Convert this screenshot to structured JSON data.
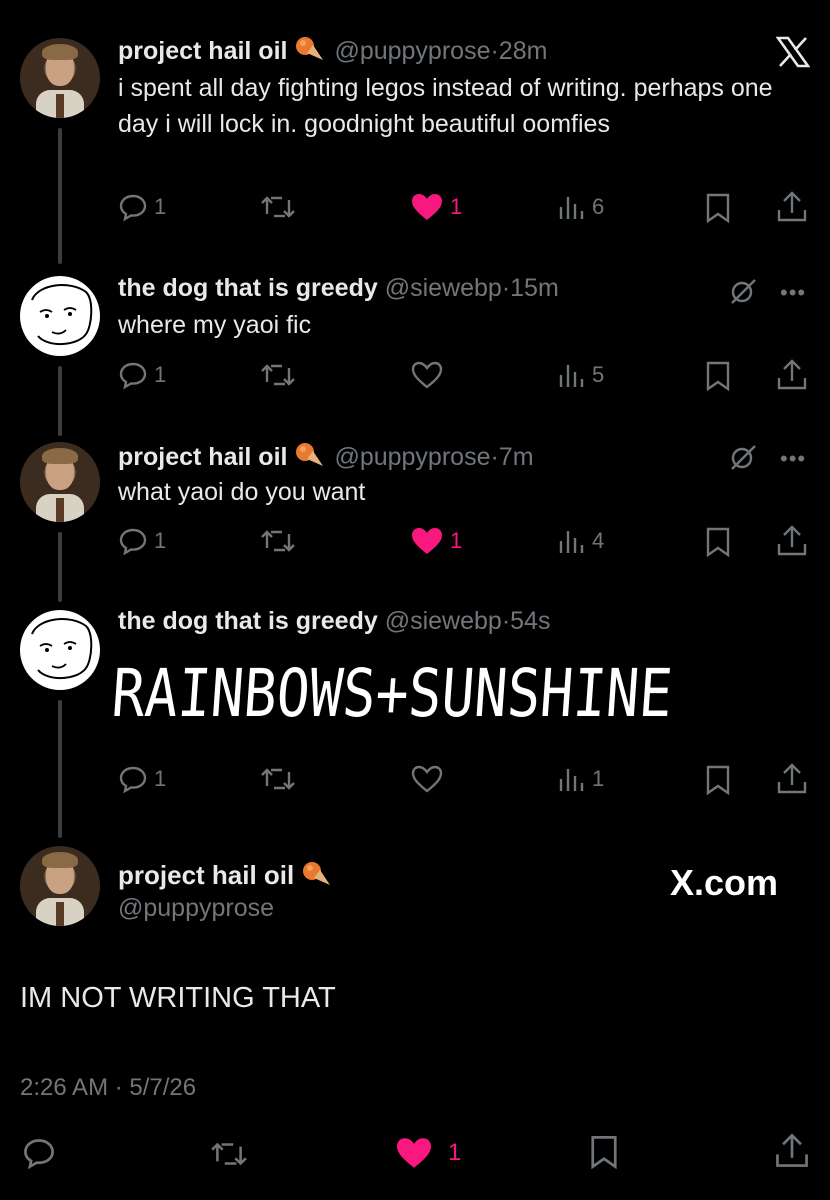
{
  "close_icon": "x-logo-icon",
  "posts": [
    {
      "name": "project hail oil",
      "handle": "@puppyprose",
      "sep": "·",
      "time": "28m",
      "text": "i spent all day fighting legos instead of writing. perhaps one day i will lock in. goodnight beautiful oomfies",
      "replies": "1",
      "likes": "1",
      "liked": true,
      "views": "6"
    },
    {
      "name": "the dog that is greedy",
      "handle": "@siewebp",
      "sep": "·",
      "time": "15m",
      "text": "where my yaoi fic",
      "replies": "1",
      "likes": "",
      "liked": false,
      "views": "5"
    },
    {
      "name": "project hail oil",
      "handle": "@puppyprose",
      "sep": "·",
      "time": "7m",
      "text": "what yaoi do you want",
      "replies": "1",
      "likes": "1",
      "liked": true,
      "views": "4"
    },
    {
      "name": "the dog that is greedy",
      "handle": "@siewebp",
      "sep": "·",
      "time": "54s",
      "text": "RAINBOWS+SUNSHINE",
      "replies": "1",
      "likes": "",
      "liked": false,
      "views": "1"
    }
  ],
  "main_post": {
    "name": "project hail oil",
    "handle": "@puppyprose",
    "brand": "X.com",
    "text": "IM NOT WRITING THAT",
    "timestamp": "2:26 AM · 5/7/26",
    "likes": "1"
  },
  "colors": {
    "like": "#f91880",
    "muted": "#71767b",
    "text": "#e7e9ea",
    "background": "#000000"
  }
}
